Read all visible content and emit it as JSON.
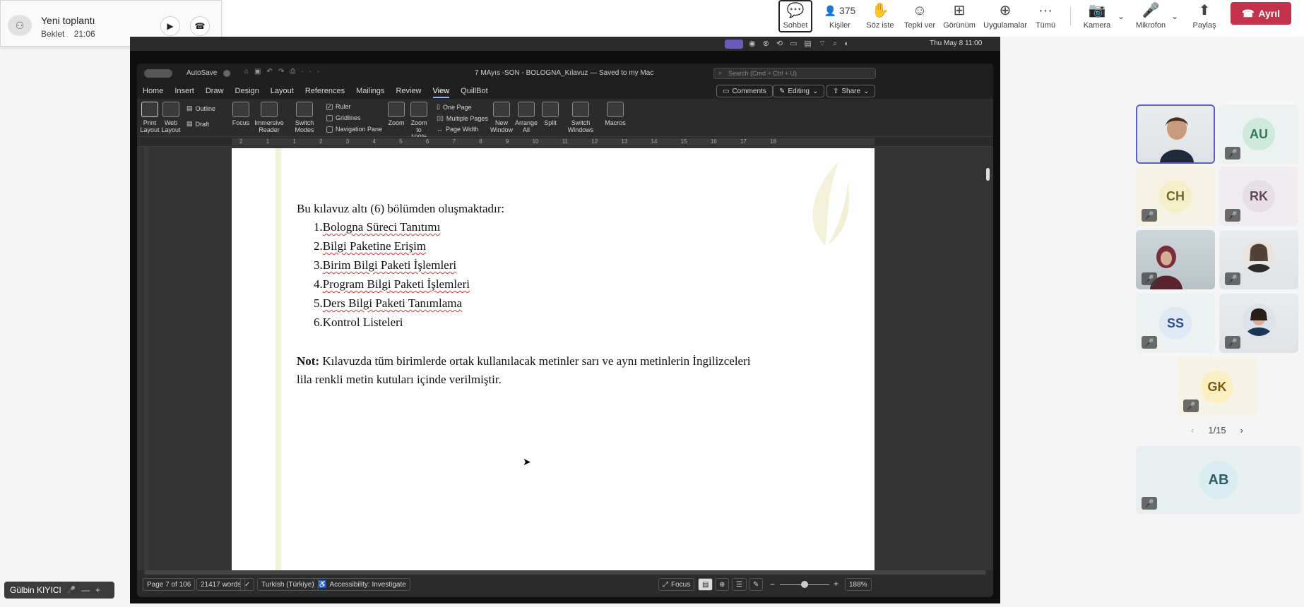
{
  "call_widget": {
    "title": "Yeni toplantı",
    "status": "Beklet",
    "time": "21:06"
  },
  "toolbar": {
    "chat": "Sohbet",
    "people_count": "375",
    "people": "Kişiler",
    "raise_hand": "Söz iste",
    "react": "Tepki ver",
    "view": "Görünüm",
    "apps": "Uygulamalar",
    "more": "Tümü",
    "camera": "Kamera",
    "mic": "Mikrofon",
    "share": "Paylaş",
    "leave": "Ayrıl"
  },
  "mac_menu": {
    "clock": "Thu May 8  11:00"
  },
  "word": {
    "autosave": "AutoSave",
    "doc_title": "7 MAyıs -SON - BOLOGNA_Kılavuz — Saved to my Mac",
    "search_placeholder": "Search (Cmd + Ctrl + U)",
    "menus": [
      "Home",
      "Insert",
      "Draw",
      "Design",
      "Layout",
      "References",
      "Mailings",
      "Review",
      "View",
      "QuillBot"
    ],
    "comments": "Comments",
    "editing": "Editing",
    "share": "Share",
    "ribbon": {
      "print_layout": "Print Layout",
      "web_layout": "Web Layout",
      "outline": "Outline",
      "draft": "Draft",
      "focus": "Focus",
      "immersive_reader": "Immersive Reader",
      "switch_modes": "Switch Modes",
      "ruler": "Ruler",
      "gridlines": "Gridlines",
      "navigation_pane": "Navigation Pane",
      "zoom": "Zoom",
      "zoom_100": "Zoom to 100%",
      "one_page": "One Page",
      "multiple_pages": "Multiple Pages",
      "page_width": "Page Width",
      "new_window": "New Window",
      "arrange_all": "Arrange All",
      "split": "Split",
      "switch_windows": "Switch Windows",
      "macros": "Macros"
    },
    "ruler_ticks": [
      "2",
      "1",
      "1",
      "2",
      "3",
      "4",
      "5",
      "6",
      "7",
      "8",
      "9",
      "10",
      "11",
      "12",
      "13",
      "14",
      "15",
      "16",
      "17",
      "18"
    ],
    "document": {
      "intro": "Bu kılavuz altı (6) bölümden oluşmaktadır:",
      "items": [
        {
          "num": "1.",
          "text": "Bologna Süreci Tanıtımı"
        },
        {
          "num": "2.",
          "text": "Bilgi Paketine Erişim"
        },
        {
          "num": "3.",
          "text": "Birim Bilgi Paketi İşlemleri"
        },
        {
          "num": "4.",
          "text": "Program Bilgi Paketi İşlemleri"
        },
        {
          "num": "5.",
          "text": "Ders Bilgi Paketi Tanımlama"
        },
        {
          "num": "6.",
          "text": "Kontrol Listeleri"
        }
      ],
      "note_label": "Not:",
      "note_line1": " Kılavuzda tüm birimlerde ortak kullanılacak metinler sarı ve aynı metinlerin İngilizceleri",
      "note_line2": "lila renkli metin kutuları içinde verilmiştir."
    },
    "status": {
      "page": "Page 7 of 106",
      "words": "21417 words",
      "language": "Turkish (Türkiye)",
      "accessibility": "Accessibility: Investigate",
      "focus": "Focus",
      "zoom": "188%"
    }
  },
  "participants": {
    "pager": "1/15",
    "initials": {
      "au": "AU",
      "ch": "CH",
      "rk": "RK",
      "ss": "SS",
      "gk": "GK",
      "ab": "AB"
    },
    "colors": {
      "au": "#cfe9dc",
      "ch": "#f3efc9",
      "rk": "#e7dfe6",
      "ss": "#dfe8f5",
      "gk": "#fbeec0",
      "ab": "#d9ecef"
    }
  },
  "presenter_chip": "Gülbin KIYICI"
}
